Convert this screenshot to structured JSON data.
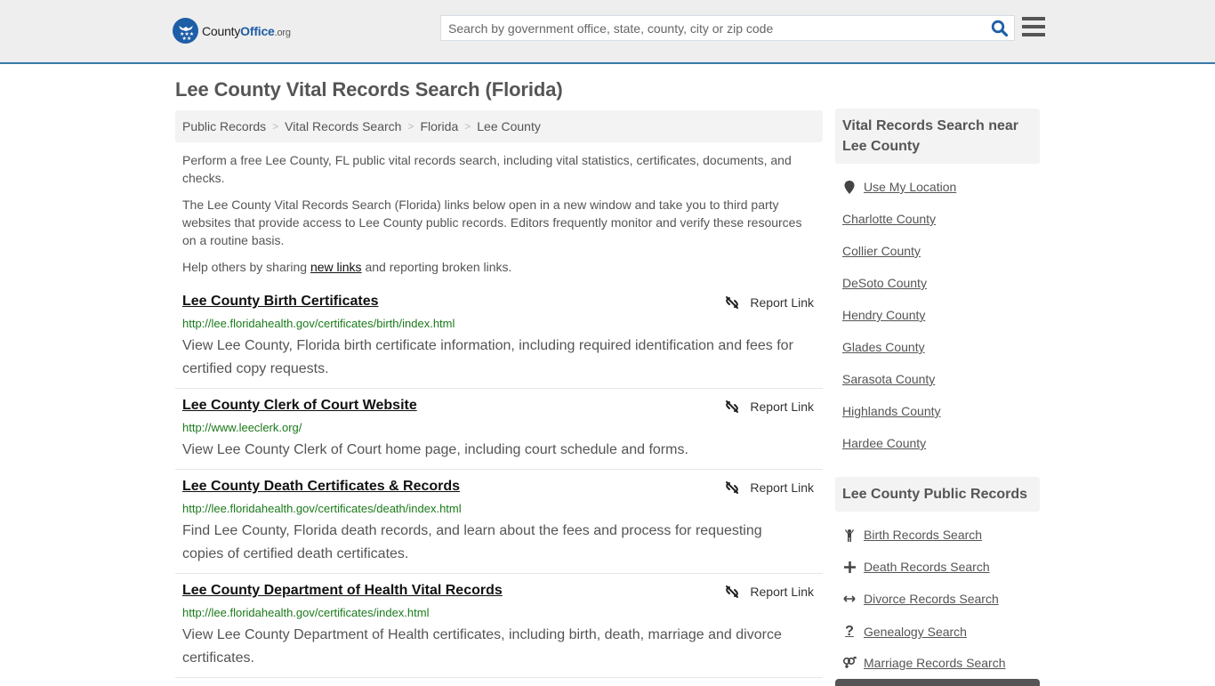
{
  "header": {
    "logo": {
      "part1": "County",
      "part2": "Office",
      "part3": ".org"
    },
    "search": {
      "placeholder": "Search by government office, state, county, city or zip code",
      "value": ""
    },
    "colors": {
      "brand": "#1e5ea7",
      "accent_border": "#3a7aa8"
    }
  },
  "page": {
    "title": "Lee County Vital Records Search (Florida)",
    "breadcrumb": [
      "Public Records",
      "Vital Records Search",
      "Florida",
      "Lee County"
    ],
    "intro": {
      "p1": "Perform a free Lee County, FL public vital records search, including vital statistics, certificates, documents, and checks.",
      "p2": "The Lee County Vital Records Search (Florida) links below open in a new window and take you to third party websites that provide access to Lee County public records. Editors frequently monitor and verify these resources on a routine basis.",
      "p3_before": "Help others by sharing ",
      "p3_link": "new links",
      "p3_after": " and reporting broken links."
    },
    "report_label": "Report Link",
    "listings": [
      {
        "title": "Lee County Birth Certificates",
        "url": "http://lee.floridahealth.gov/certificates/birth/index.html",
        "desc": "View Lee County, Florida birth certificate information, including required identification and fees for certified copy requests."
      },
      {
        "title": "Lee County Clerk of Court Website",
        "url": "http://www.leeclerk.org/",
        "desc": "View Lee County Clerk of Court home page, including court schedule and forms."
      },
      {
        "title": "Lee County Death Certificates & Records",
        "url": "http://lee.floridahealth.gov/certificates/death/index.html",
        "desc": "Find Lee County, Florida death records, and learn about the fees and process for requesting copies of certified death certificates."
      },
      {
        "title": "Lee County Department of Health Vital Records",
        "url": "http://lee.floridahealth.gov/certificates/index.html",
        "desc": "View Lee County Department of Health certificates, including birth, death, marriage and divorce certificates."
      }
    ]
  },
  "sidebar": {
    "nearby": {
      "heading": "Vital Records Search near Lee County",
      "use_location": "Use My Location",
      "counties": [
        "Charlotte County",
        "Collier County",
        "DeSoto County",
        "Hendry County",
        "Glades County",
        "Sarasota County",
        "Highlands County",
        "Hardee County"
      ]
    },
    "public_records": {
      "heading": "Lee County Public Records",
      "items": [
        {
          "label": "Birth Records Search",
          "icon": "child-icon"
        },
        {
          "label": "Death Records Search",
          "icon": "cross-icon"
        },
        {
          "label": "Divorce Records Search",
          "icon": "arrows-horizontal-icon"
        },
        {
          "label": "Genealogy Search",
          "icon": "question-icon"
        },
        {
          "label": "Marriage Records Search",
          "icon": "venus-mars-icon"
        }
      ]
    }
  }
}
